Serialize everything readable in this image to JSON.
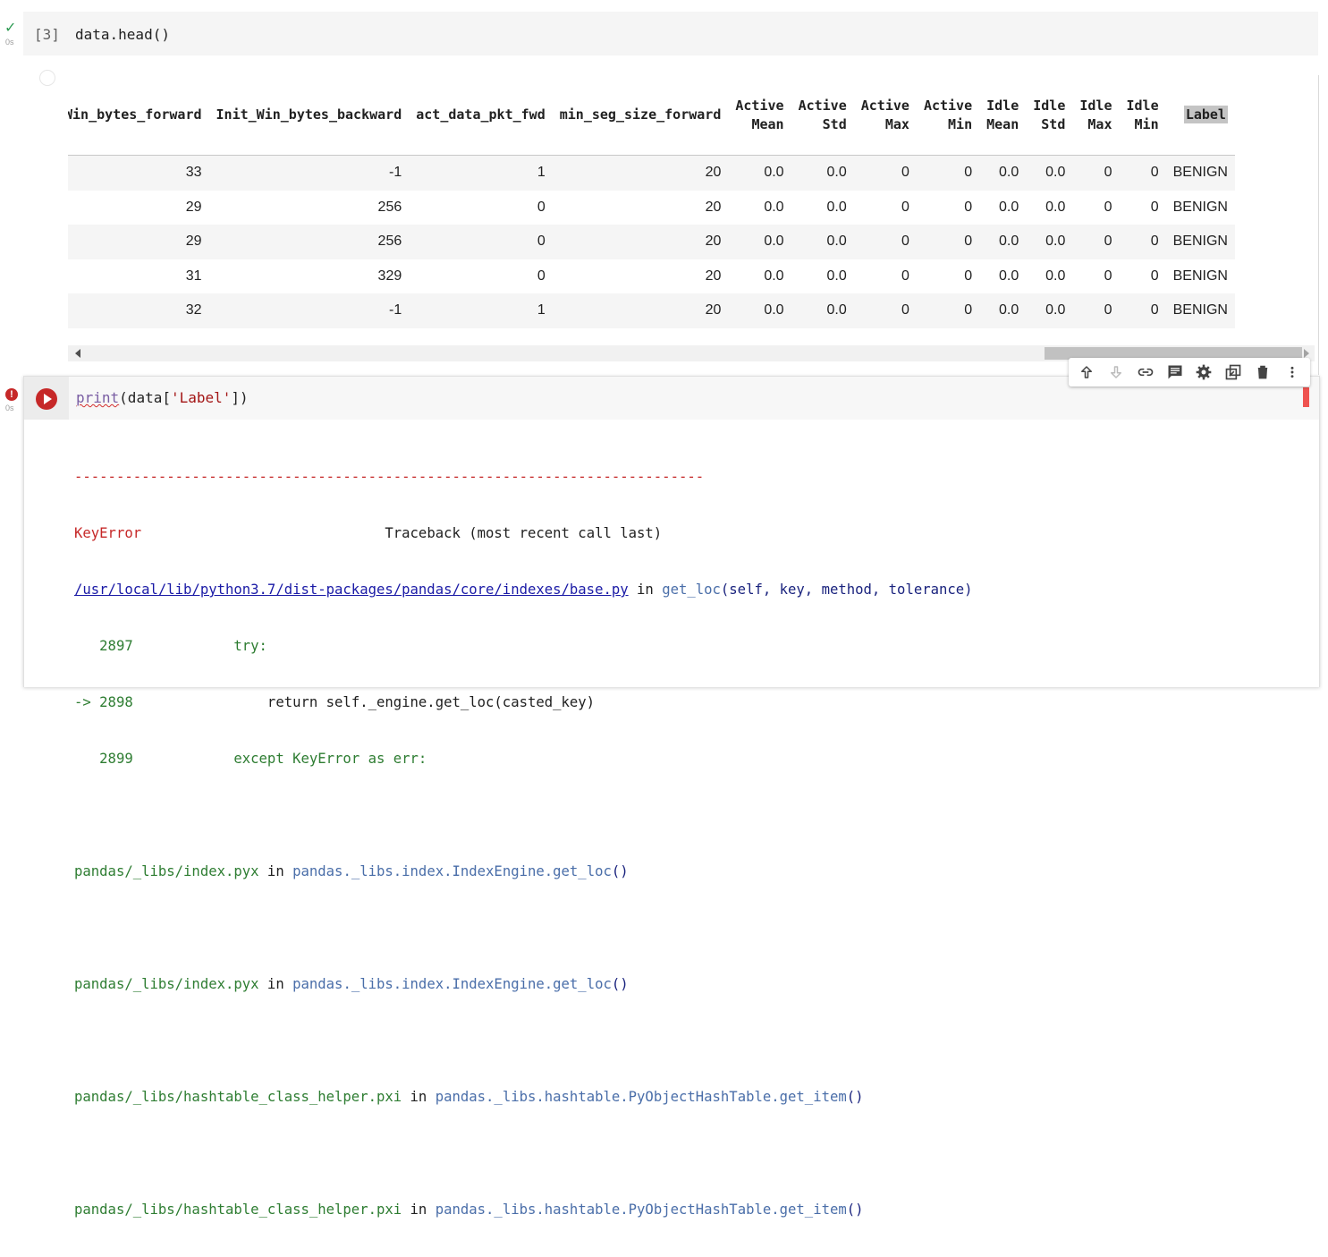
{
  "cell1": {
    "exec_count": "[3]",
    "exec_time": "0s",
    "code": "data.head()"
  },
  "table": {
    "headers": [
      [
        "Win_bytes_forward"
      ],
      [
        "Init_Win_bytes_backward"
      ],
      [
        "act_data_pkt_fwd"
      ],
      [
        "min_seg_size_forward"
      ],
      [
        "Active",
        "Mean"
      ],
      [
        "Active",
        "Std"
      ],
      [
        "Active",
        "Max"
      ],
      [
        "Active",
        "Min"
      ],
      [
        "Idle",
        "Mean"
      ],
      [
        "Idle",
        "Std"
      ],
      [
        "Idle",
        "Max"
      ],
      [
        "Idle",
        "Min"
      ],
      [
        "Label"
      ]
    ],
    "rows": [
      [
        "33",
        "-1",
        "1",
        "20",
        "0.0",
        "0.0",
        "0",
        "0",
        "0.0",
        "0.0",
        "0",
        "0",
        "BENIGN"
      ],
      [
        "29",
        "256",
        "0",
        "20",
        "0.0",
        "0.0",
        "0",
        "0",
        "0.0",
        "0.0",
        "0",
        "0",
        "BENIGN"
      ],
      [
        "29",
        "256",
        "0",
        "20",
        "0.0",
        "0.0",
        "0",
        "0",
        "0.0",
        "0.0",
        "0",
        "0",
        "BENIGN"
      ],
      [
        "31",
        "329",
        "0",
        "20",
        "0.0",
        "0.0",
        "0",
        "0",
        "0.0",
        "0.0",
        "0",
        "0",
        "BENIGN"
      ],
      [
        "32",
        "-1",
        "1",
        "20",
        "0.0",
        "0.0",
        "0",
        "0",
        "0.0",
        "0.0",
        "0",
        "0",
        "BENIGN"
      ]
    ]
  },
  "cell2": {
    "exec_time": "0s",
    "error_badge": "!",
    "code_fn": "print",
    "code_mid": "(data[",
    "code_str": "'Label'",
    "code_end": "])"
  },
  "toolbar": {
    "icons": [
      "arrow-up-icon",
      "arrow-down-icon",
      "link-icon",
      "comment-icon",
      "gear-icon",
      "mirror-cell-icon",
      "trash-icon",
      "more-vert-icon"
    ]
  },
  "traceback": {
    "dashes": "---------------------------------------------------------------------------",
    "error_type": "KeyError",
    "header_right": "Traceback (most recent call last)",
    "file1": "/usr/local/lib/python3.7/dist-packages/pandas/core/indexes/base.py",
    "in": " in ",
    "func1": "get_loc",
    "func1_args": "(self, key, method, tolerance)",
    "l2897_num": "   2897",
    "l2897_code": "            try:",
    "l2898_num": "-> 2898",
    "l2898_code": "                return self._engine.get_loc(casted_key)",
    "l2899_num": "   2899",
    "l2899_code": "            except KeyError as err:",
    "f2_file": "pandas/_libs/index.pyx",
    "f2_func": "pandas._libs.index.IndexEngine.get_loc",
    "f2_tail": "()",
    "f3_file": "pandas/_libs/index.pyx",
    "f3_func": "pandas._libs.index.IndexEngine.get_loc",
    "f3_tail": "()",
    "f4_file": "pandas/_libs/hashtable_class_helper.pxi",
    "f4_func": "pandas._libs.hashtable.PyObjectHashTable.get_item",
    "f4_tail": "()",
    "f5_file": "pandas/_libs/hashtable_class_helper.pxi",
    "f5_func": "pandas._libs.hashtable.PyObjectHashTable.get_item",
    "f5_tail": "()"
  }
}
